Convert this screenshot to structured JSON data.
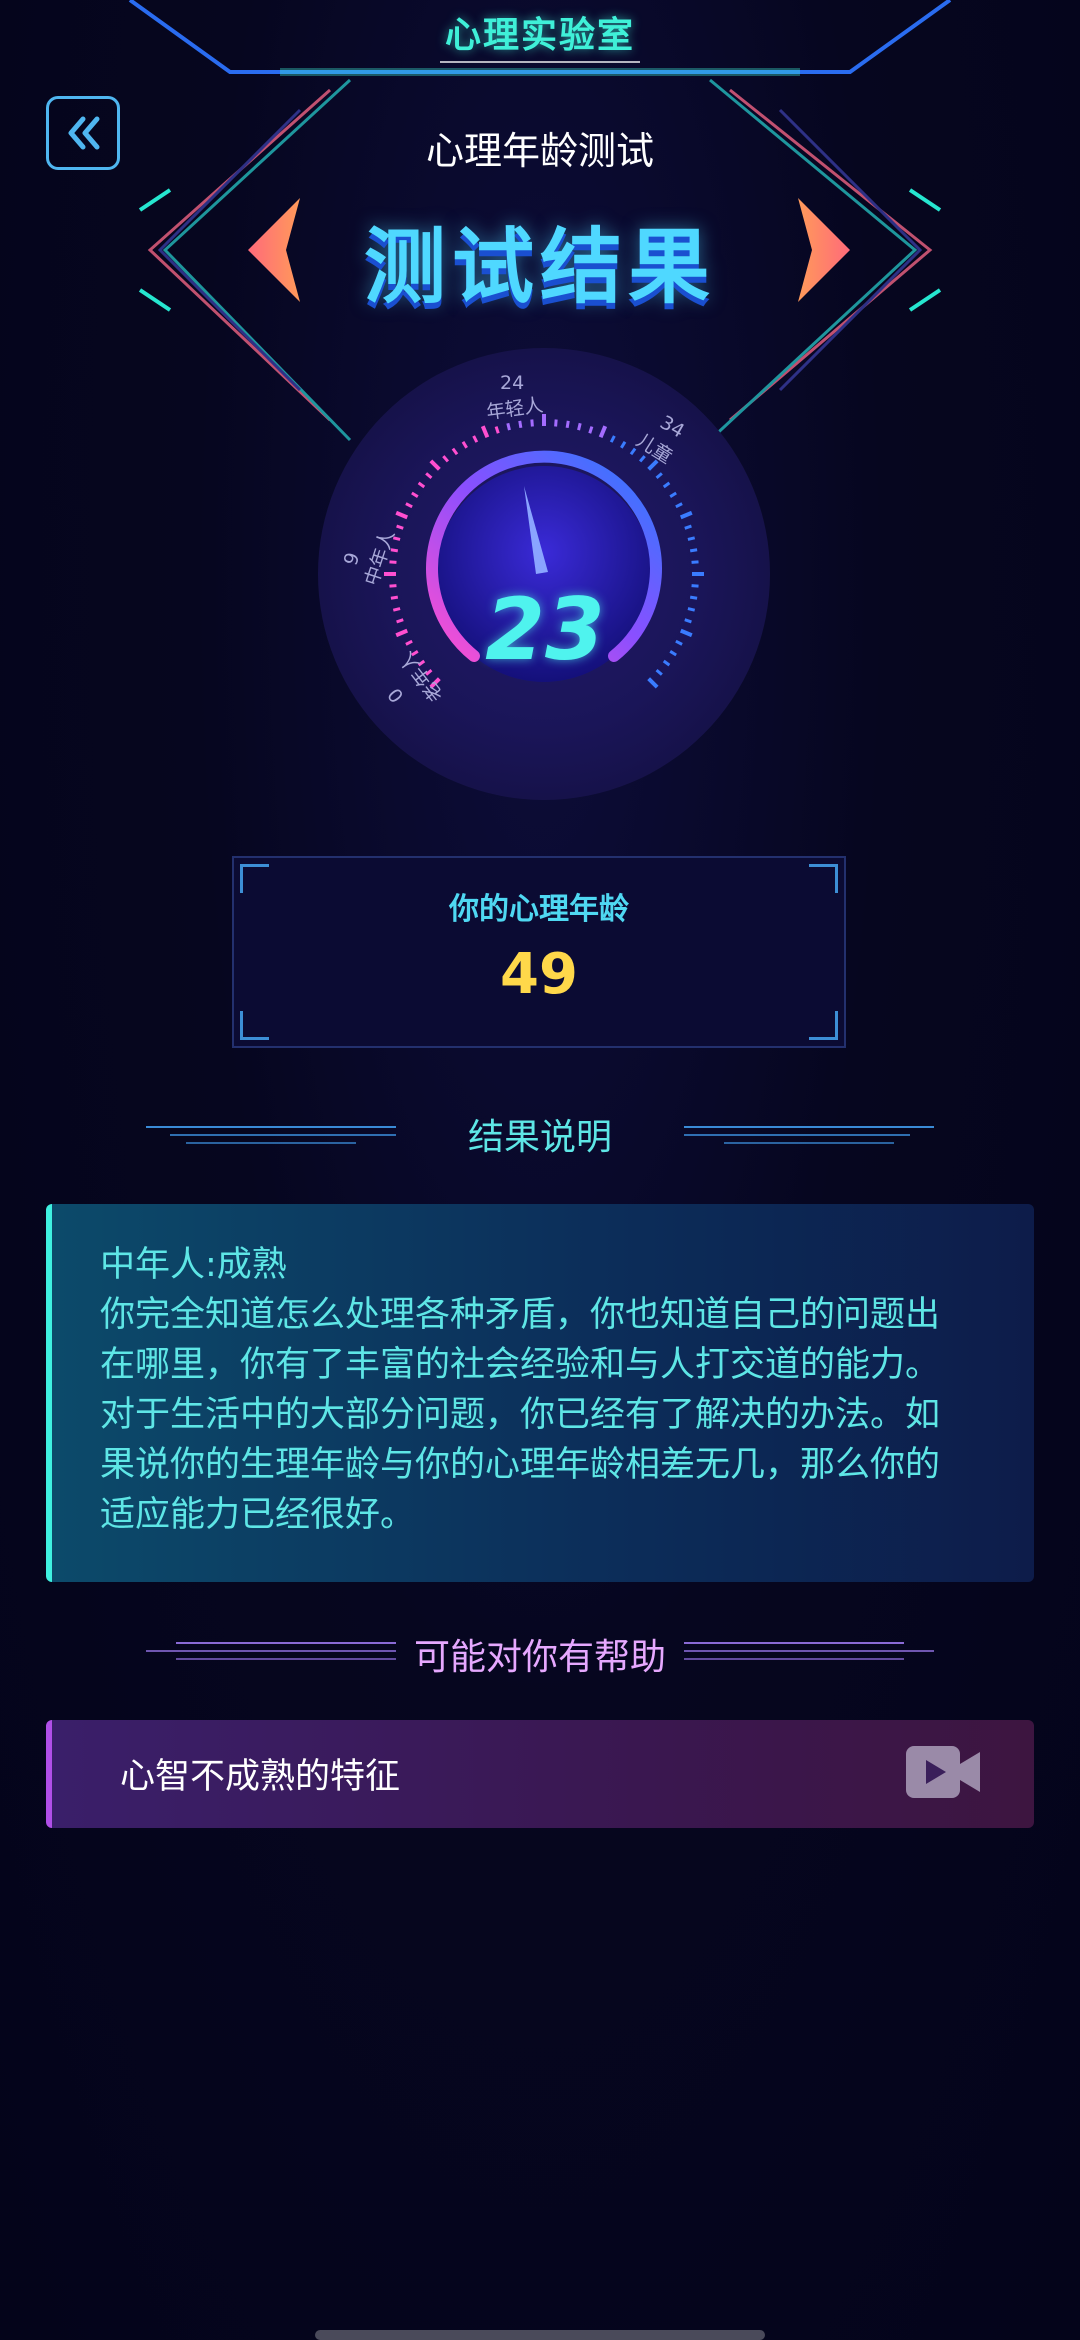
{
  "header": {
    "lab_title": "心理实验室",
    "test_name": "心理年龄测试",
    "result_title": "测试结果",
    "back_icon": "double-chevron-left-icon"
  },
  "gauge": {
    "value": "23",
    "ticks": {
      "t0": "0",
      "t0_label": "老年人",
      "t9": "9",
      "t9_label": "中年人",
      "t24": "24",
      "t24_label": "年轻人",
      "t34": "34",
      "t34_label": "儿童"
    }
  },
  "age_box": {
    "label": "你的心理年龄",
    "value": "49"
  },
  "explanation": {
    "section_title": "结果说明",
    "heading": "中年人:成熟",
    "lines": [
      "你完全知道怎么处理各种矛盾，你也知道自己的问题出",
      "在哪里，你有了丰富的社会经验和与人打交道的能力。",
      "对于生活中的大部分问题，你已经有了解决的办法。如",
      "果说你的生理年龄与你的心理年龄相差无几，那么你的",
      "适应能力已经很好。"
    ]
  },
  "help": {
    "section_title": "可能对你有帮助",
    "item_label": "心智不成熟的特征",
    "item_icon": "video-play-icon"
  },
  "colors": {
    "accent_cyan": "#3ff0d8",
    "age_value": "#ffd84a",
    "help_accent": "#b04fe8"
  }
}
